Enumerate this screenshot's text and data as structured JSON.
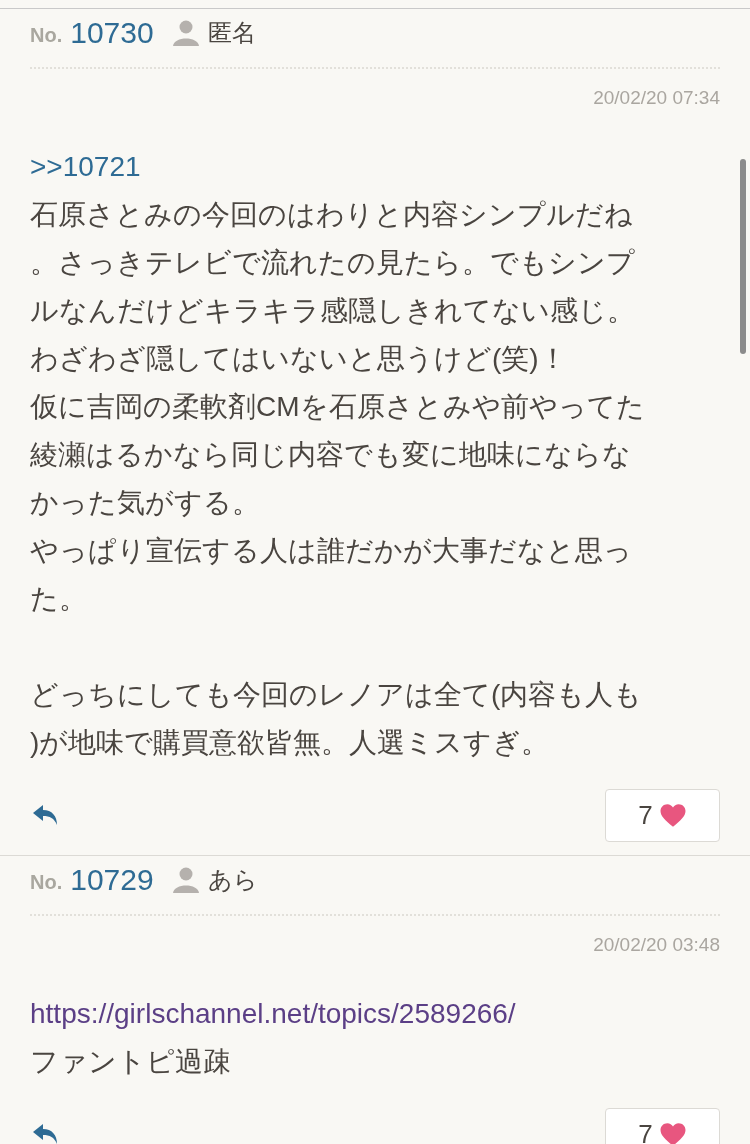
{
  "posts": [
    {
      "no_label": "No.",
      "number": "10730",
      "author": "匿名",
      "date": "20/02/20 07:34",
      "body": [
        {
          "kind": "anchor",
          "lines": [
            ">>10721"
          ]
        },
        {
          "kind": "text",
          "lines": [
            "石原さとみの今回のはわりと内容シンプルだね",
            "。さっきテレビで流れたの見たら。でもシンプ",
            "ルなんだけどキラキラ感隠しきれてない感じ。",
            "わざわざ隠してはいないと思うけど(笑)！",
            "仮に吉岡の柔軟剤CMを石原さとみや前やってた",
            "綾瀬はるかなら同じ内容でも変に地味にならな",
            "かった気がする。",
            "やっぱり宣伝する人は誰だかが大事だなと思っ",
            "た。"
          ]
        },
        {
          "kind": "text",
          "lines": [
            "どっちにしても今回のレノアは全て(内容も人も",
            ")が地味で購買意欲皆無。人選ミスすぎ。"
          ]
        }
      ],
      "likes": "7"
    },
    {
      "no_label": "No.",
      "number": "10729",
      "author": "あら",
      "date": "20/02/20 03:48",
      "body": [
        {
          "kind": "url",
          "lines": [
            "https://girlschannel.net/topics/2589266/"
          ]
        },
        {
          "kind": "text",
          "lines": [
            "ファントピ過疎"
          ]
        }
      ],
      "likes": "7"
    }
  ]
}
